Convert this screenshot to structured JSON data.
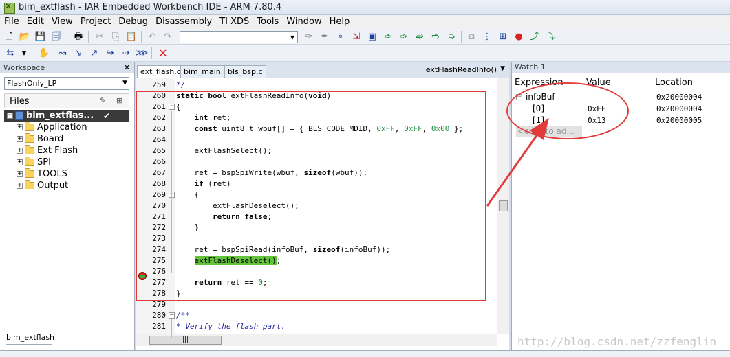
{
  "window": {
    "title": "bim_extflash - IAR Embedded Workbench IDE - ARM 7.80.4"
  },
  "menu": [
    "File",
    "Edit",
    "View",
    "Project",
    "Debug",
    "Disassembly",
    "TI XDS",
    "Tools",
    "Window",
    "Help"
  ],
  "workspace": {
    "header": "Workspace",
    "close": "×",
    "config": "FlashOnly_LP",
    "files_header": "Files",
    "root": "bim_extflas...",
    "check": "✔",
    "folders": [
      "Application",
      "Board",
      "Ext Flash",
      "SPI",
      "TOOLS",
      "Output"
    ],
    "bottom_tab": "bim_extflash"
  },
  "editor": {
    "tabs": [
      "ext_flash.c",
      "bim_main.c",
      "bls_bsp.c"
    ],
    "function_selector": "extFlashReadInfo()",
    "line_numbers": [
      "259",
      "260",
      "261",
      "262",
      "263",
      "264",
      "265",
      "266",
      "267",
      "268",
      "269",
      "270",
      "271",
      "272",
      "273",
      "274",
      "275",
      "276",
      "277",
      "278",
      "279",
      "280",
      "281"
    ],
    "current_line": "275"
  },
  "watch": {
    "title": "Watch 1",
    "columns": [
      "Expression",
      "Value",
      "Location"
    ],
    "rows": [
      {
        "expr": "infoBuf",
        "value": "",
        "location": "0x20000004"
      },
      {
        "expr": "[0]",
        "value": "0xEF",
        "location": "0x20000004"
      },
      {
        "expr": "[1]",
        "value": "0x13",
        "location": "0x20000005"
      }
    ],
    "add_placeholder": "<click to ad..."
  },
  "watermark": "http://blog.csdn.net/zzfenglin",
  "colors": {
    "annotation": "#e23b3b",
    "pc_highlight": "#63c43b"
  }
}
